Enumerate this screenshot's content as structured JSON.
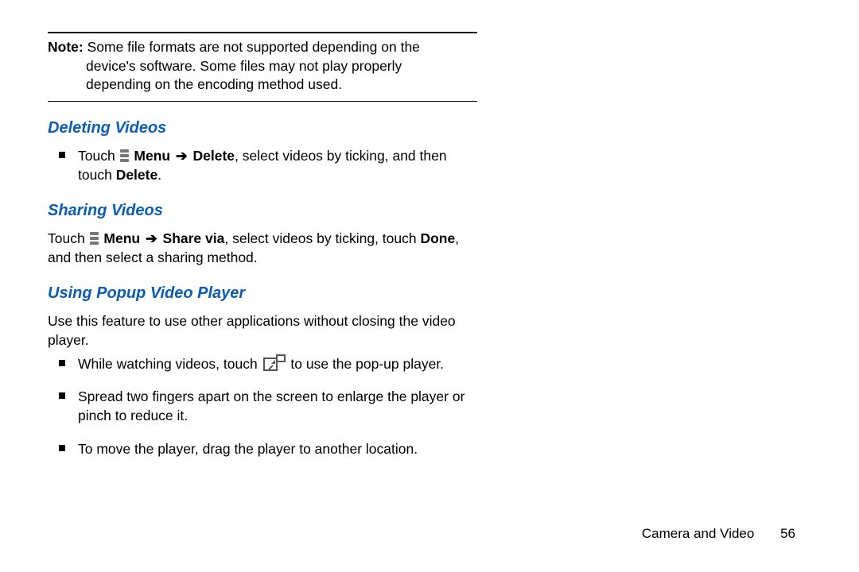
{
  "note": {
    "label": "Note:",
    "line1_after_label": " Some file formats are not supported depending on the",
    "line2": "device's software. Some files may not play properly",
    "line3": "depending on the encoding method used."
  },
  "sections": {
    "deleting": {
      "heading": "Deleting Videos",
      "bullet": {
        "p_touch": "Touch ",
        "p_menu": " Menu ",
        "p_arrow": "➔",
        "p_delete": " Delete",
        "p_rest1": ", select videos by ticking, and then touch ",
        "p_delete2": "Delete",
        "p_period": "."
      }
    },
    "sharing": {
      "heading": "Sharing Videos",
      "para": {
        "p_touch": "Touch ",
        "p_menu": " Menu ",
        "p_arrow": "➔",
        "p_share": " Share via",
        "p_rest1": ", select videos by ticking, touch ",
        "p_done": "Done",
        "p_rest2": ", and then select a sharing method."
      }
    },
    "popup": {
      "heading": "Using Popup Video Player",
      "intro": "Use this feature to use other applications without closing the video player.",
      "bullets": {
        "b1_pre": "While watching videos, touch ",
        "b1_post": " to use the pop-up player.",
        "b2": "Spread two fingers apart on the screen to enlarge the player or pinch to reduce it.",
        "b3": "To move the player, drag the player to another location."
      }
    }
  },
  "footer": {
    "section": "Camera and Video",
    "page": "56"
  }
}
